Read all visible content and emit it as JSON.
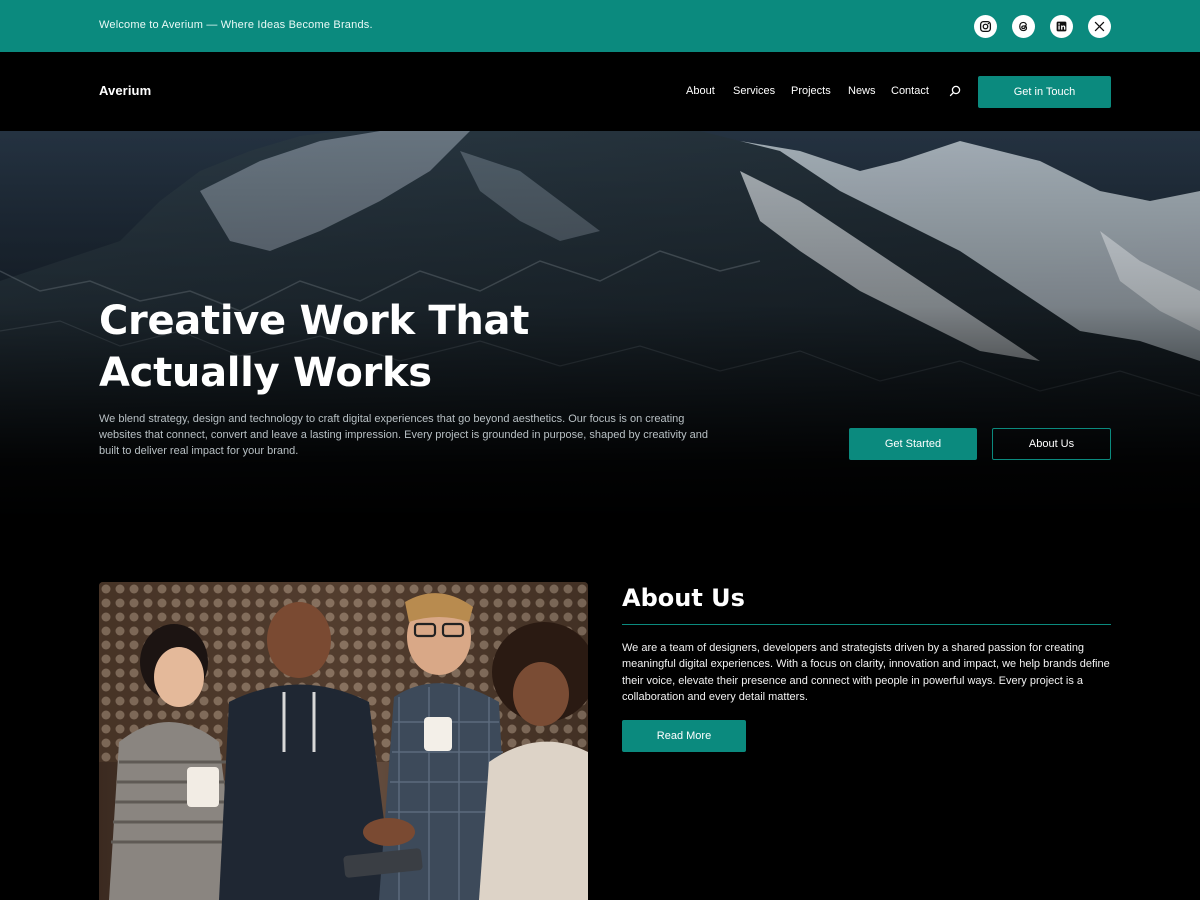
{
  "topbar": {
    "welcome": "Welcome to Averium — Where Ideas Become Brands.",
    "social": [
      {
        "name": "instagram-icon"
      },
      {
        "name": "threads-icon"
      },
      {
        "name": "linkedin-icon"
      },
      {
        "name": "x-icon"
      }
    ]
  },
  "header": {
    "logo": "Averium",
    "nav": [
      "About",
      "Services",
      "Projects",
      "News",
      "Contact"
    ],
    "cta": "Get in Touch"
  },
  "hero": {
    "title": "Creative Work That Actually Works",
    "description": "We blend strategy, design and technology to craft digital experiences that go beyond aesthetics. Our focus is on creating websites that connect, convert and leave a lasting impression. Every project is grounded in purpose, shaped by creativity and built to deliver real impact for your brand.",
    "primary_button": "Get Started",
    "secondary_button": "About Us"
  },
  "about": {
    "title": "About Us",
    "text": "We are a team of designers, developers and strategists driven by a shared passion for creating meaningful digital experiences. With a focus on clarity, innovation and impact, we help brands define their voice, elevate their presence and connect with people in powerful ways. Every project is a collaboration and every detail matters.",
    "button": "Read More"
  },
  "colors": {
    "accent": "#0b8a7e",
    "background": "#000000"
  }
}
